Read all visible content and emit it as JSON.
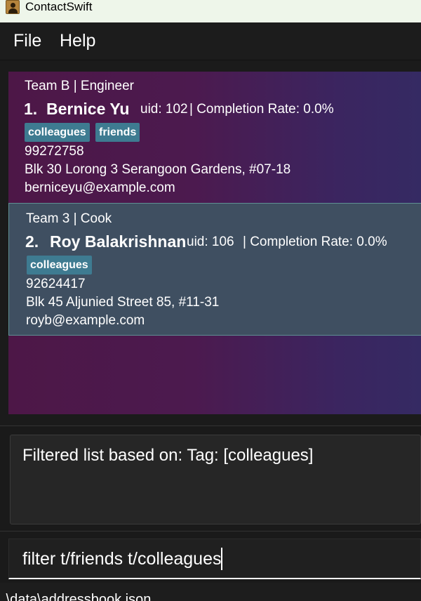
{
  "window": {
    "title": "ContactSwift"
  },
  "menu": {
    "file": "File",
    "help": "Help"
  },
  "persons": [
    {
      "team": "Team B | Engineer",
      "index": "1.",
      "name": "Bernice Yu",
      "uid": "uid: 102",
      "completion": "| Completion Rate: 0.0%",
      "tags": [
        "colleagues",
        "friends"
      ],
      "phone": "99272758",
      "address": "Blk 30 Lorong 3 Serangoon Gardens, #07-18",
      "email": "berniceyu@example.com",
      "selected": false
    },
    {
      "team": "Team 3 | Cook",
      "index": "2.",
      "name": "Roy Balakrishnan",
      "uid": "uid: 106",
      "completion": "| Completion Rate: 0.0%",
      "tags": [
        "colleagues"
      ],
      "phone": "92624417",
      "address": "Blk 45 Aljunied Street 85, #11-31",
      "email": "royb@example.com",
      "selected": true
    }
  ],
  "result": {
    "message": "Filtered list based on: Tag: [colleagues]"
  },
  "command": {
    "value": "filter t/friends t/colleagues"
  },
  "status": {
    "path": ".\\data\\addressbook.json"
  },
  "colors": {
    "tag": "#3e7b91",
    "selected_card": "#3f4f61",
    "list_gradient_start": "#4d1747",
    "list_gradient_end": "#352a63"
  }
}
